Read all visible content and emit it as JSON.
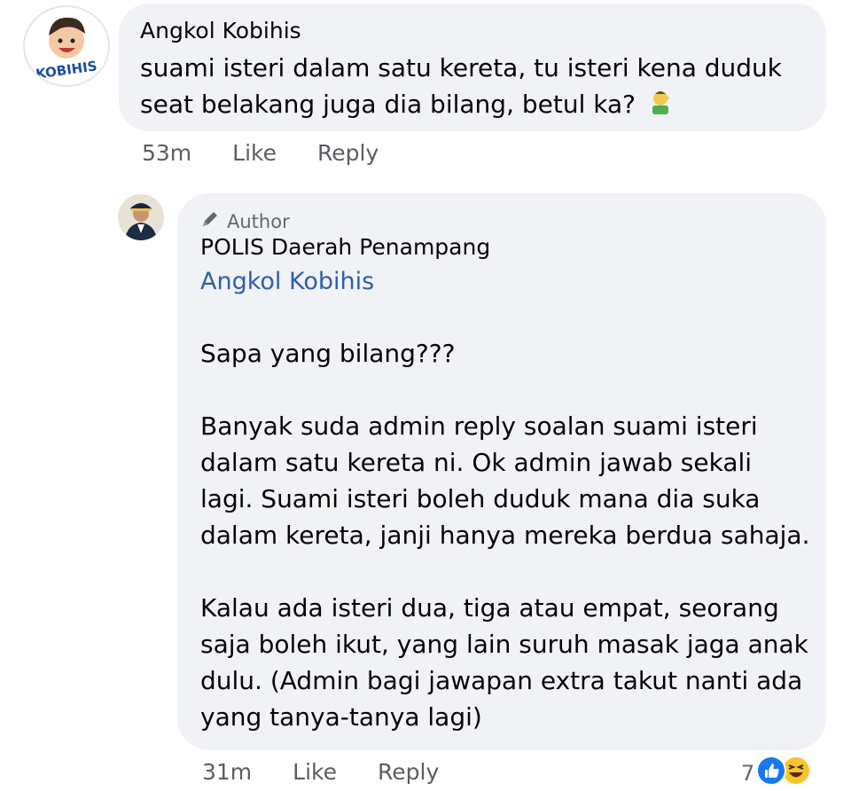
{
  "comment": {
    "author": "Angkol Kobihis",
    "avatar_text": "KOBIHIS",
    "text": "suami isteri dalam satu kereta, tu isteri kena duduk seat belakang juga dia bilang, betul ka?",
    "emoji": "face-palm-emoji",
    "time": "53m",
    "like_label": "Like",
    "reply_label": "Reply"
  },
  "reply": {
    "badge_label": "Author",
    "author": "POLIS Daerah Penampang",
    "mention": "Angkol Kobihis",
    "paragraphs": [
      "Sapa yang bilang???",
      "Banyak suda admin reply soalan suami isteri dalam satu kereta ni. Ok admin jawab sekali lagi. Suami isteri boleh duduk mana dia suka dalam kereta, janji hanya mereka berdua sahaja.",
      "Kalau ada isteri dua, tiga atau empat, seorang saja boleh ikut, yang lain suruh masak jaga anak dulu. (Admin bagi jawapan extra takut nanti ada yang tanya-tanya lagi)"
    ],
    "time": "31m",
    "like_label": "Like",
    "reply_label": "Reply",
    "reaction_count": "7",
    "reactions": [
      "like-reaction-icon",
      "haha-reaction-icon"
    ]
  },
  "colors": {
    "bubble": "#f0f2f5",
    "mention": "#2f5fa8",
    "like_blue": "#1877f2",
    "haha_yellow": "#f7c52b"
  }
}
